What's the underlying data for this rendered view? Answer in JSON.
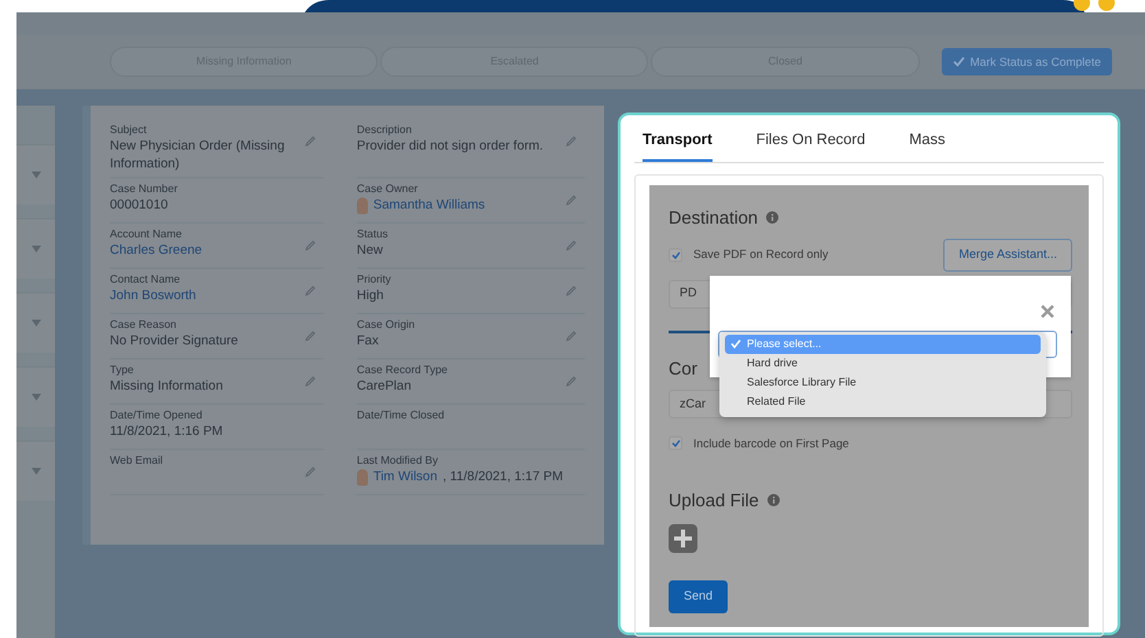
{
  "path": {
    "stages": [
      {
        "label": "Missing Information"
      },
      {
        "label": "Escalated"
      },
      {
        "label": "Closed"
      }
    ],
    "action": "Mark Status as Complete"
  },
  "details": {
    "fields": [
      {
        "label": "Subject",
        "value": "New Physician Order (Missing Information)",
        "kind": "text",
        "editable": true
      },
      {
        "label": "Description",
        "value": "Provider did not sign order form.",
        "kind": "text",
        "editable": true
      },
      {
        "label": "Case Number",
        "value": "00001010",
        "kind": "text",
        "editable": false
      },
      {
        "label": "Case Owner",
        "value": "Samantha Williams",
        "kind": "user",
        "editable": true
      },
      {
        "label": "Account Name",
        "value": "Charles Greene",
        "kind": "link",
        "editable": true
      },
      {
        "label": "Status",
        "value": "New",
        "kind": "text",
        "editable": true
      },
      {
        "label": "Contact Name",
        "value": "John Bosworth",
        "kind": "link",
        "editable": true
      },
      {
        "label": "Priority",
        "value": "High",
        "kind": "text",
        "editable": true
      },
      {
        "label": "Case Reason",
        "value": "No Provider Signature",
        "kind": "text",
        "editable": true
      },
      {
        "label": "Case Origin",
        "value": "Fax",
        "kind": "text",
        "editable": true
      },
      {
        "label": "Type",
        "value": "Missing Information",
        "kind": "text",
        "editable": true
      },
      {
        "label": "Case Record Type",
        "value": "CarePlan",
        "kind": "text",
        "editable": true
      },
      {
        "label": "Date/Time Opened",
        "value": "11/8/2021, 1:16 PM",
        "kind": "text",
        "editable": false
      },
      {
        "label": "Date/Time Closed",
        "editable": false
      },
      {
        "label": "Web Email",
        "editable": true
      },
      {
        "label": "Last Modified By",
        "value": "Tim Wilson",
        "rest": ", 11/8/2021, 1:17 PM",
        "kind": "user",
        "editable": false
      }
    ]
  },
  "panel": {
    "tabs": [
      {
        "label": "Transport",
        "selected": true
      },
      {
        "label": "Files On Record",
        "selected": false
      },
      {
        "label": "Mass",
        "selected": false
      }
    ],
    "destination_title": "Destination",
    "save_pdf": {
      "label": "Save PDF on Record only",
      "checked": true
    },
    "merge_button": "Merge Assistant...",
    "destination_field": "PD",
    "second_title": "Cor",
    "second_field": "zCar",
    "barcode": {
      "label": "Include barcode on First Page",
      "checked": true
    },
    "upload_title": "Upload File",
    "send_button": "Send"
  },
  "dialog": {
    "options": [
      {
        "label": "Please select...",
        "selected": true
      },
      {
        "label": "Hard drive",
        "selected": false
      },
      {
        "label": "Salesforce Library File",
        "selected": false
      },
      {
        "label": "Related File",
        "selected": false
      }
    ]
  }
}
